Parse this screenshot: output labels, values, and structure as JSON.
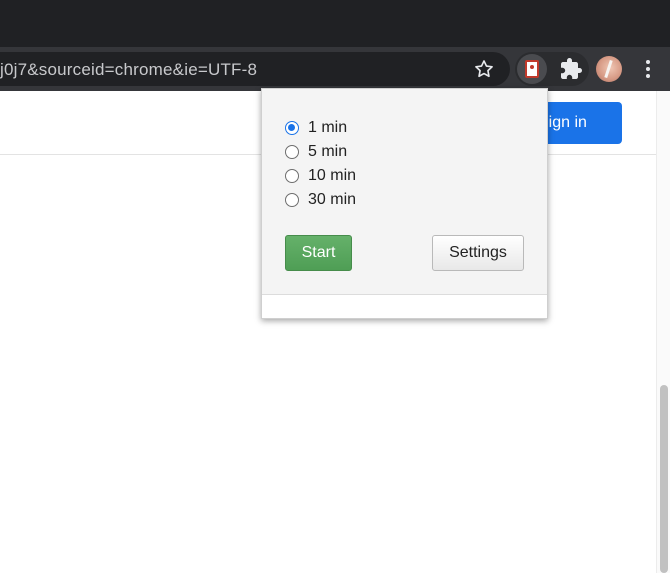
{
  "browser": {
    "omnibox_url": "j0j7&sourceid=chrome&ie=UTF-8"
  },
  "icons": {
    "star": "star-icon",
    "extension_active": "timer-extension-icon",
    "puzzle": "puzzle-icon",
    "avatar": "avatar",
    "menu": "kebab-menu-icon"
  },
  "page": {
    "signin_label": "Sign in"
  },
  "popup": {
    "options": [
      {
        "label": "1 min",
        "checked": true
      },
      {
        "label": "5 min",
        "checked": false
      },
      {
        "label": "10 min",
        "checked": false
      },
      {
        "label": "30 min",
        "checked": false
      }
    ],
    "start_label": "Start",
    "settings_label": "Settings"
  },
  "colors": {
    "accent_blue": "#1a73e8",
    "start_green": "#5aa860",
    "toolbar_dark": "#35363a",
    "tabstrip_dark": "#202124"
  }
}
